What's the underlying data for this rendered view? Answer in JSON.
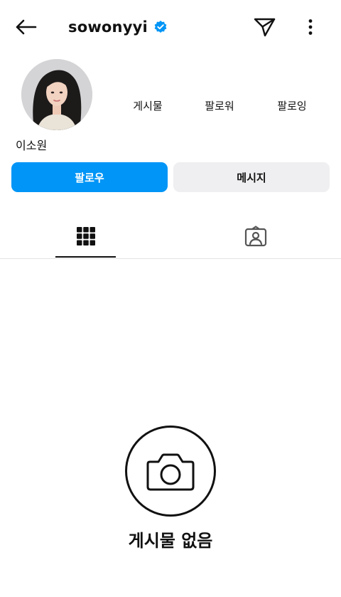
{
  "header": {
    "username": "sowonyyi",
    "verified": true,
    "icons": [
      "back-arrow-icon",
      "verified-badge-icon",
      "send-icon",
      "more-vertical-icon"
    ]
  },
  "profile": {
    "display_name": "이소원",
    "stats": {
      "posts_label": "게시물",
      "followers_label": "팔로워",
      "following_label": "팔로잉"
    }
  },
  "actions": {
    "follow_label": "팔로우",
    "message_label": "메시지"
  },
  "tabs": [
    {
      "name": "grid",
      "icon": "grid-icon",
      "active": true
    },
    {
      "name": "tagged",
      "icon": "tagged-person-icon",
      "active": false
    }
  ],
  "empty_state": {
    "icon": "camera-icon",
    "text": "게시물 없음"
  },
  "colors": {
    "accent": "#0095f6",
    "verified": "#0095f6",
    "secondary_button": "#efeff1"
  }
}
